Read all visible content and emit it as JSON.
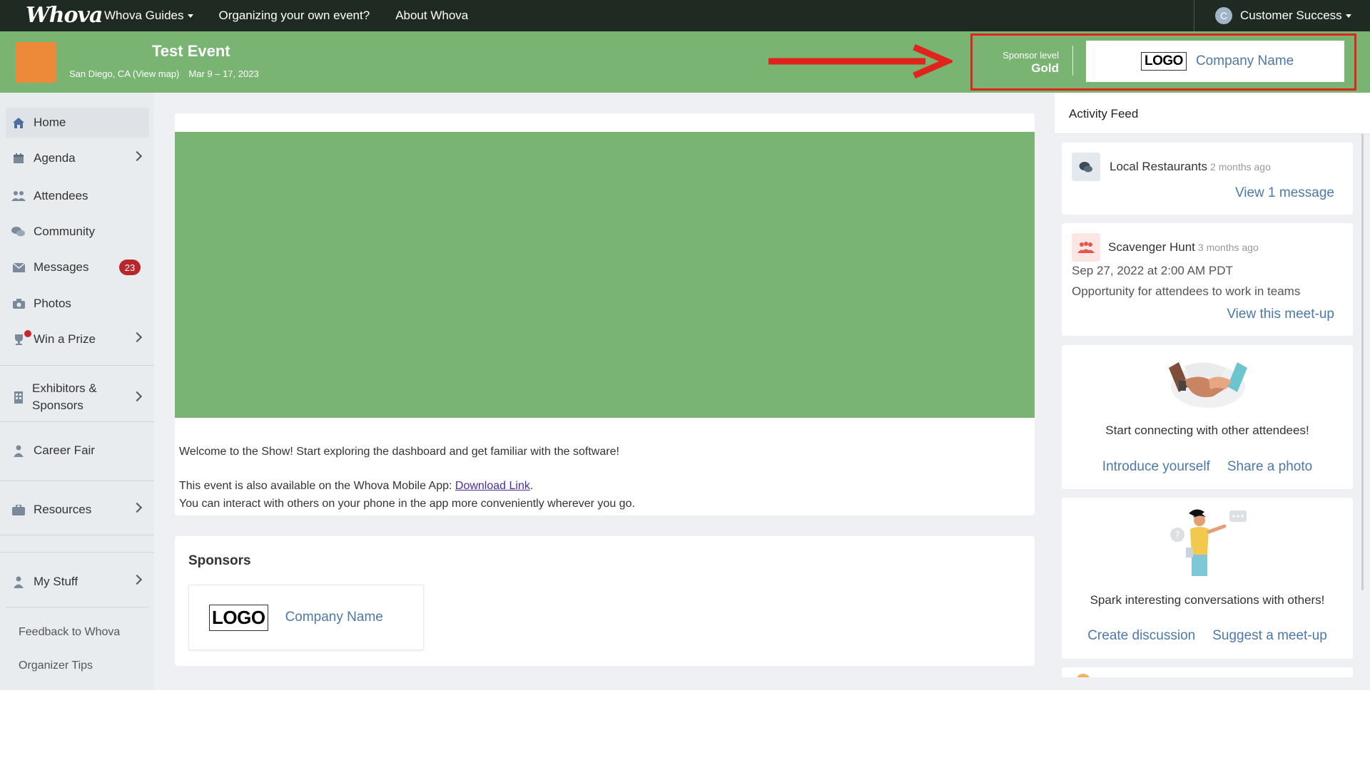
{
  "topnav": {
    "logo": "Whova",
    "links": [
      "Whova Guides",
      "Organizing your own event?",
      "About Whova"
    ],
    "user_initial": "C",
    "user_name": "Customer Success"
  },
  "event": {
    "title": "Test Event",
    "location": "San Diego, CA (View map)",
    "dates": "Mar 9 – 17, 2023",
    "sponsor_level_label": "Sponsor level",
    "sponsor_level_value": "Gold",
    "sponsor_logo": "LOGO",
    "sponsor_company": "Company Name"
  },
  "sidebar": {
    "items": [
      {
        "label": "Home"
      },
      {
        "label": "Agenda"
      },
      {
        "label": "Attendees"
      },
      {
        "label": "Community"
      },
      {
        "label": "Messages",
        "badge": "23"
      },
      {
        "label": "Photos"
      },
      {
        "label": "Win a Prize"
      },
      {
        "label_line1": "Exhibitors &",
        "label_line2": "Sponsors"
      },
      {
        "label": "Career Fair"
      },
      {
        "label": "Resources"
      },
      {
        "label": "My Stuff"
      }
    ],
    "footer_links": [
      "Feedback to Whova",
      "Organizer Tips"
    ]
  },
  "main": {
    "welcome_line": "Welcome to the Show! Start exploring the dashboard and get familiar with the software!",
    "app_line_prefix": "This event is also available on the Whova Mobile App: ",
    "download_link": "Download Link",
    "app_line_suffix": ".",
    "interact_line": "You can interact with others on your phone in the app more conveniently wherever you go.",
    "sponsors_title": "Sponsors",
    "sponsor_logo": "LOGO",
    "sponsor_company": "Company Name"
  },
  "feed": {
    "title": "Activity Feed",
    "items": [
      {
        "name": "Local Restaurants",
        "ago": "2 months ago",
        "link": "View 1 message"
      },
      {
        "name": "Scavenger Hunt",
        "ago": "3 months ago",
        "date": "Sep 27, 2022 at 2:00 AM PDT",
        "desc": "Opportunity for attendees to work in teams",
        "link": "View this meet-up"
      }
    ],
    "connect_text": "Start connecting with other attendees!",
    "connect_actions": [
      "Introduce yourself",
      "Share a photo"
    ],
    "spark_text": "Spark interesting conversations with others!",
    "spark_actions": [
      "Create discussion",
      "Suggest a meet-up"
    ]
  },
  "colors": {
    "topnav_bg": "#1f2a22",
    "header_green": "#79b473",
    "event_thumb": "#ec8a3a",
    "link_blue": "#4c79a8",
    "badge_red": "#b8262c",
    "highlight_red": "#e0241b"
  },
  "icons": [
    "home-icon",
    "calendar-icon",
    "users-icon",
    "chat-icon",
    "mail-icon",
    "camera-icon",
    "trophy-icon",
    "building-icon",
    "person-icon",
    "briefcase-icon",
    "user-icon",
    "chevron-right-icon",
    "arrow-right-icon"
  ]
}
